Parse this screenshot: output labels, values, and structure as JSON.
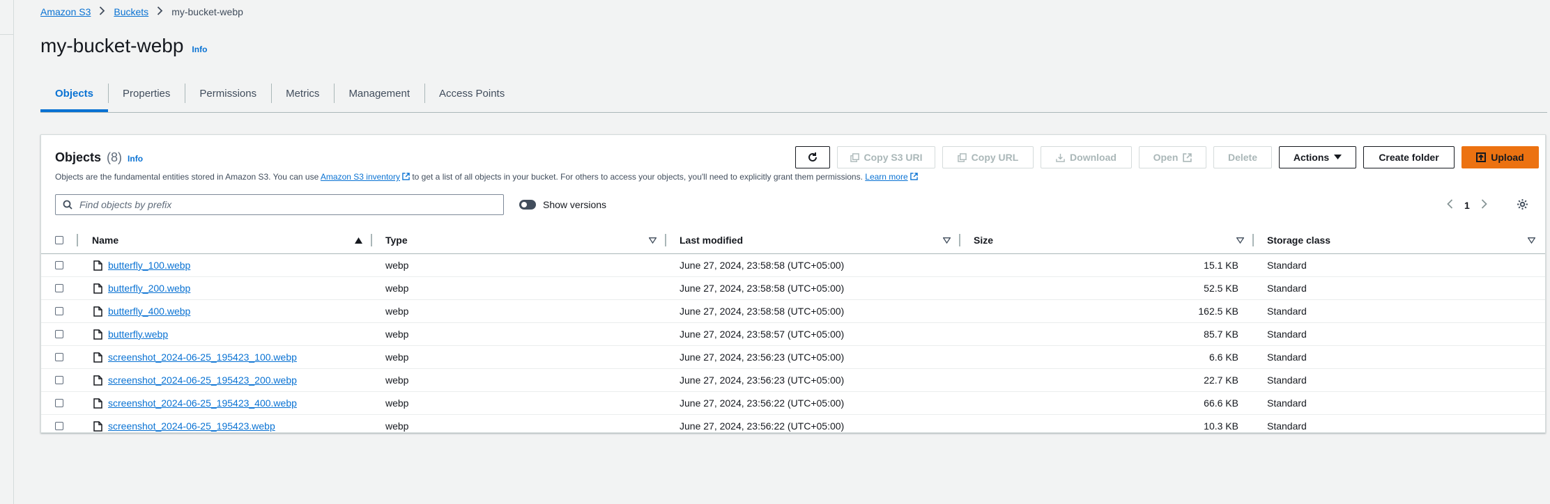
{
  "breadcrumb": {
    "root": "Amazon S3",
    "buckets": "Buckets",
    "current": "my-bucket-webp"
  },
  "header": {
    "title": "my-bucket-webp",
    "info": "Info"
  },
  "tabs": [
    "Objects",
    "Properties",
    "Permissions",
    "Metrics",
    "Management",
    "Access Points"
  ],
  "objects_panel": {
    "title": "Objects",
    "count": "(8)",
    "info": "Info",
    "desc_before": "Objects are the fundamental entities stored in Amazon S3. You can use",
    "desc_link1": "Amazon S3 inventory",
    "desc_middle": "to get a list of all objects in your bucket. For others to access your objects, you'll need to explicitly grant them permissions.",
    "desc_link2": "Learn more"
  },
  "toolbar": {
    "copy_uri": "Copy S3 URI",
    "copy_url": "Copy URL",
    "download": "Download",
    "open": "Open",
    "delete": "Delete",
    "actions": "Actions",
    "create_folder": "Create folder",
    "upload": "Upload"
  },
  "search": {
    "placeholder": "Find objects by prefix"
  },
  "show_versions": "Show versions",
  "pagination": {
    "page": "1"
  },
  "table": {
    "columns": [
      "Name",
      "Type",
      "Last modified",
      "Size",
      "Storage class"
    ],
    "rows": [
      {
        "name": "butterfly_100.webp",
        "type": "webp",
        "modified": "June 27, 2024, 23:58:58 (UTC+05:00)",
        "size": "15.1 KB",
        "storage": "Standard"
      },
      {
        "name": "butterfly_200.webp",
        "type": "webp",
        "modified": "June 27, 2024, 23:58:58 (UTC+05:00)",
        "size": "52.5 KB",
        "storage": "Standard"
      },
      {
        "name": "butterfly_400.webp",
        "type": "webp",
        "modified": "June 27, 2024, 23:58:58 (UTC+05:00)",
        "size": "162.5 KB",
        "storage": "Standard"
      },
      {
        "name": "butterfly.webp",
        "type": "webp",
        "modified": "June 27, 2024, 23:58:57 (UTC+05:00)",
        "size": "85.7 KB",
        "storage": "Standard"
      },
      {
        "name": "screenshot_2024-06-25_195423_100.webp",
        "type": "webp",
        "modified": "June 27, 2024, 23:56:23 (UTC+05:00)",
        "size": "6.6 KB",
        "storage": "Standard"
      },
      {
        "name": "screenshot_2024-06-25_195423_200.webp",
        "type": "webp",
        "modified": "June 27, 2024, 23:56:23 (UTC+05:00)",
        "size": "22.7 KB",
        "storage": "Standard"
      },
      {
        "name": "screenshot_2024-06-25_195423_400.webp",
        "type": "webp",
        "modified": "June 27, 2024, 23:56:22 (UTC+05:00)",
        "size": "66.6 KB",
        "storage": "Standard"
      },
      {
        "name": "screenshot_2024-06-25_195423.webp",
        "type": "webp",
        "modified": "June 27, 2024, 23:56:22 (UTC+05:00)",
        "size": "10.3 KB",
        "storage": "Standard"
      }
    ]
  },
  "colors": {
    "link": "#0972d3",
    "upload": "#ec7211",
    "text": "#16191f",
    "background": "#f2f3f3"
  }
}
